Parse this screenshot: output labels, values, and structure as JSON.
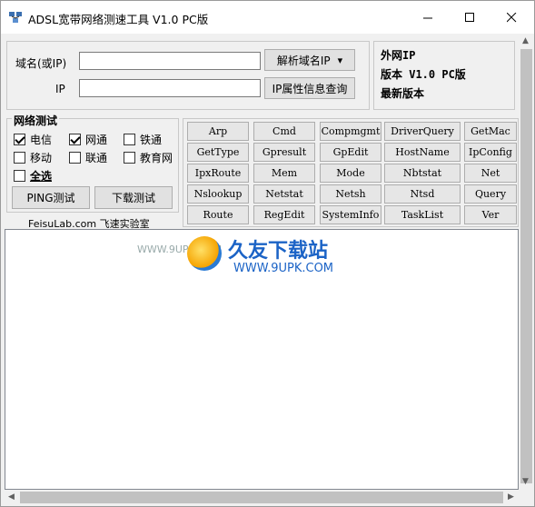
{
  "window": {
    "title": "ADSL宽带网络测速工具 V1.0 PC版",
    "controls": {
      "minimize": "─",
      "maximize": "☐",
      "close": "✕"
    }
  },
  "domain_panel": {
    "domain_label": "域名(或IP)",
    "domain_value": "",
    "resolve_button": "解析域名IP",
    "resolve_arrow": "▾",
    "ip_label": "IP",
    "ip_value": "",
    "ip_query_button": "IP属性信息查询"
  },
  "info_panel": {
    "line1": "外网IP",
    "line2": "版本 V1.0 PC版",
    "line3": "最新版本"
  },
  "network_test": {
    "title": "网络测试",
    "options": [
      {
        "label": "电信",
        "checked": true
      },
      {
        "label": "网通",
        "checked": true
      },
      {
        "label": "铁通",
        "checked": false
      },
      {
        "label": "移动",
        "checked": false
      },
      {
        "label": "联通",
        "checked": false
      },
      {
        "label": "教育网",
        "checked": false
      }
    ],
    "select_all": {
      "label": "全选",
      "checked": false
    },
    "ping_button": "PING测试",
    "download_button": "下载测试",
    "footer": "FeisuLab.com 飞速实验室"
  },
  "tools": {
    "row1": [
      "Arp",
      "Cmd",
      "Compmgmt",
      "DriverQuery",
      "GetMac"
    ],
    "row2": [
      "GetType",
      "Gpresult",
      "GpEdit",
      "HostName",
      "IpConfig"
    ],
    "row3": [
      "IpxRoute",
      "Mem",
      "Mode",
      "Nbtstat",
      "Net"
    ],
    "row4": [
      "Nslookup",
      "Netstat",
      "Netsh",
      "Ntsd",
      "Query"
    ],
    "row5": [
      "Route",
      "RegEdit",
      "SystemInfo",
      "TaskList",
      "Ver"
    ]
  },
  "watermark": {
    "small": "WWW.9UPK.COM",
    "title": "久友下载站",
    "url": "WWW.9UPK.COM"
  },
  "scroll": {
    "up": "▲",
    "down": "▼",
    "left": "◀",
    "right": "▶"
  }
}
